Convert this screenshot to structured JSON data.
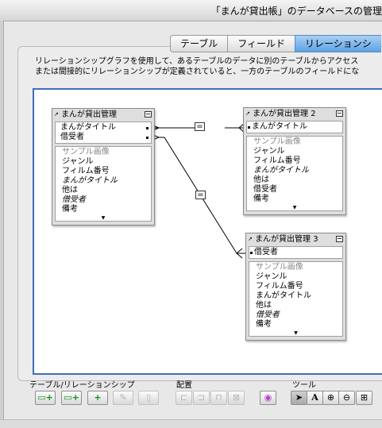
{
  "window": {
    "title": "「まんが貸出帳」のデータベースの管理"
  },
  "tabs": [
    {
      "label": "テーブル",
      "active": false
    },
    {
      "label": "フィールド",
      "active": false
    },
    {
      "label": "リレーションシ",
      "active": true
    }
  ],
  "description": [
    "リレーションシップグラフを使用して、あるテーブルのデータに別のテーブルからアクセス",
    "または間接的にリレーションシップが定義されていると、一方のテーブルのフィールドにな"
  ],
  "occurrences": [
    {
      "name": "まんが貸出管理",
      "keys": [
        "まんがタイトル",
        "借受者"
      ],
      "fields": [
        {
          "label": "サンプル画像",
          "style": "gray"
        },
        {
          "label": "ジャンル",
          "style": ""
        },
        {
          "label": "フィルム番号",
          "style": ""
        },
        {
          "label": "まんがタイトル",
          "style": "italic"
        },
        {
          "label": "他は",
          "style": ""
        },
        {
          "label": "借受者",
          "style": "italic"
        },
        {
          "label": "備考",
          "style": ""
        }
      ]
    },
    {
      "name": "まんが貸出管理 2",
      "keys": [
        "まんがタイトル"
      ],
      "fields": [
        {
          "label": "サンプル画像",
          "style": "gray"
        },
        {
          "label": "ジャンル",
          "style": ""
        },
        {
          "label": "フィルム番号",
          "style": ""
        },
        {
          "label": "まんがタイトル",
          "style": "italic"
        },
        {
          "label": "他は",
          "style": ""
        },
        {
          "label": "借受者",
          "style": ""
        },
        {
          "label": "備考",
          "style": ""
        }
      ]
    },
    {
      "name": "まんが貸出管理 3",
      "keys": [
        "借受者"
      ],
      "fields": [
        {
          "label": "サンプル画像",
          "style": "gray"
        },
        {
          "label": "ジャンル",
          "style": ""
        },
        {
          "label": "フィルム番号",
          "style": ""
        },
        {
          "label": "まんがタイトル",
          "style": ""
        },
        {
          "label": "他は",
          "style": ""
        },
        {
          "label": "借受者",
          "style": "italic"
        },
        {
          "label": "備考",
          "style": ""
        }
      ]
    }
  ],
  "relationships": [
    {
      "operator": "="
    },
    {
      "operator": "="
    }
  ],
  "toolbar": {
    "tables_label": "テーブル/リレーションシップ",
    "arrange_label": "配置",
    "tools_label": "ツール",
    "table_buttons": [
      {
        "icon": "add-table-icon",
        "glyph": "▭+",
        "enabled": true
      },
      {
        "icon": "duplicate-table-icon",
        "glyph": "▭+",
        "enabled": true
      },
      {
        "icon": "add-relationship-icon",
        "glyph": "+",
        "enabled": true
      },
      {
        "icon": "edit-pencil-icon",
        "glyph": "✎",
        "enabled": false
      },
      {
        "icon": "delete-trash-icon",
        "glyph": "▯",
        "enabled": false
      }
    ],
    "arrange_buttons": [
      {
        "icon": "align-left-icon",
        "glyph": "⊏"
      },
      {
        "icon": "align-center-icon",
        "glyph": "⊐"
      },
      {
        "icon": "distribute-horizontal-icon",
        "glyph": "⊓"
      },
      {
        "icon": "resize-icon",
        "glyph": "⊠"
      }
    ],
    "color_button": {
      "icon": "color-picker-icon",
      "glyph": "◉"
    },
    "tool_buttons": [
      {
        "icon": "pointer-arrow-icon",
        "glyph": "➤",
        "selected": true
      },
      {
        "icon": "text-tool-icon",
        "glyph": "A",
        "selected": false
      },
      {
        "icon": "zoom-in-icon",
        "glyph": "⊕",
        "selected": false
      },
      {
        "icon": "zoom-out-icon",
        "glyph": "⊖",
        "selected": false
      },
      {
        "icon": "page-view-icon",
        "glyph": "⊞",
        "selected": false
      }
    ]
  }
}
